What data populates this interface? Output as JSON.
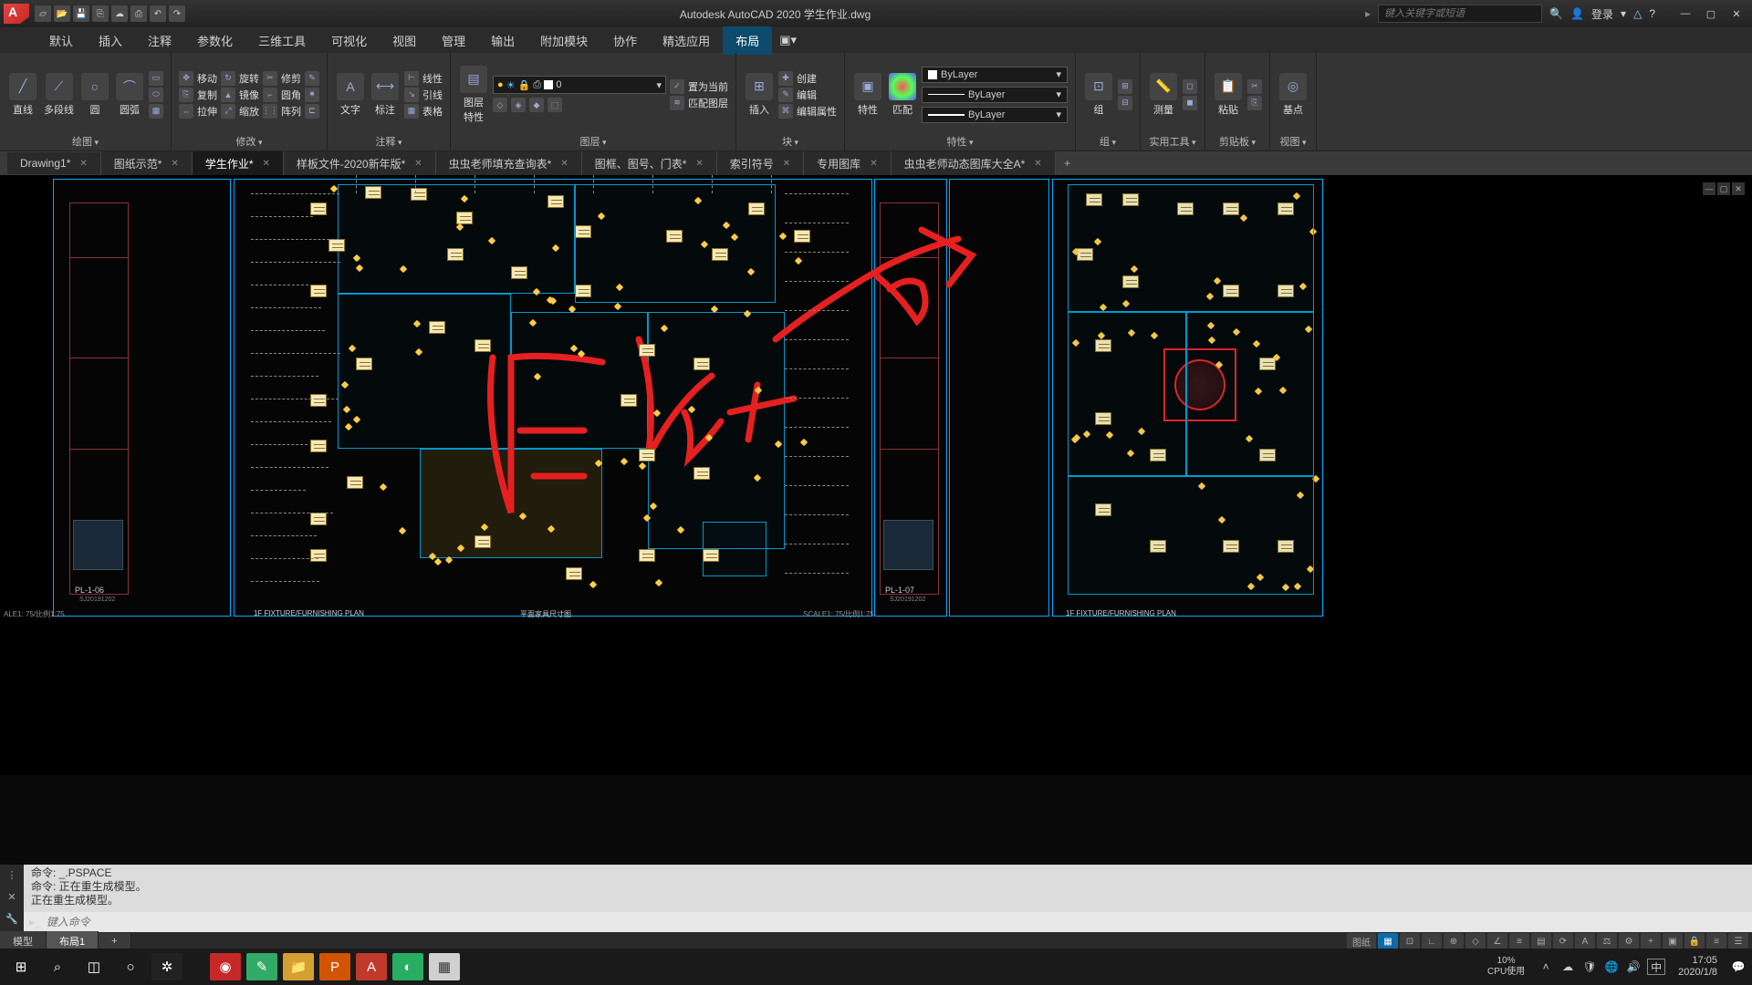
{
  "app": {
    "title": "Autodesk AutoCAD 2020   学生作业.dwg",
    "search_placeholder": "键入关键字或短语",
    "login": "登录"
  },
  "menu": {
    "items": [
      "默认",
      "插入",
      "注释",
      "参数化",
      "三维工具",
      "可视化",
      "视图",
      "管理",
      "输出",
      "附加模块",
      "协作",
      "精选应用",
      "布局"
    ],
    "active": 12
  },
  "ribbon": {
    "draw": {
      "label": "绘图",
      "line": "直线",
      "pline": "多段线",
      "circle": "圆",
      "arc": "圆弧"
    },
    "modify": {
      "label": "修改",
      "move": "移动",
      "rotate": "旋转",
      "trim": "修剪",
      "copy": "复制",
      "mirror": "镜像",
      "fillet": "圆角",
      "stretch": "拉伸",
      "scale": "缩放",
      "array": "阵列"
    },
    "annot": {
      "label": "注释",
      "text": "文字",
      "dim": "标注",
      "linear": "线性",
      "leader": "引线",
      "table": "表格"
    },
    "layers": {
      "label": "图层",
      "props": "图层\n特性",
      "current": "0",
      "setcur": "置为当前",
      "match": "匹配图层"
    },
    "block": {
      "label": "块",
      "insert": "插入",
      "create": "创建",
      "edit": "编辑",
      "editattr": "编辑属性"
    },
    "props": {
      "label": "特性",
      "prop": "特性",
      "match": "匹配",
      "bylayer": "ByLayer",
      "bylayer2": "ByLayer",
      "bylayer3": "ByLayer"
    },
    "group": {
      "label": "组",
      "grp": "组"
    },
    "util": {
      "label": "实用工具",
      "measure": "测量"
    },
    "clip": {
      "label": "剪贴板",
      "paste": "粘贴"
    },
    "view": {
      "label": "视图",
      "base": "基点"
    }
  },
  "tabs": {
    "items": [
      {
        "name": "Drawing1*"
      },
      {
        "name": "图纸示范*"
      },
      {
        "name": "学生作业*"
      },
      {
        "name": "样板文件-2020新年版*"
      },
      {
        "name": "虫虫老师填充查询表*"
      },
      {
        "name": "图框、图号、门表*"
      },
      {
        "name": "索引符号"
      },
      {
        "name": "专用图库"
      },
      {
        "name": "虫虫老师动态图库大全A*"
      }
    ],
    "active": 2
  },
  "drawing": {
    "scale_left": "ALE1: 75/比例1:75",
    "scale_right": "SCALE1: 75/比例1:75",
    "plan1_title": "1F FIXTURE/FURNISHING PLAN",
    "plan2_title": "平面家具尺寸图",
    "plan3_title": "1F FIXTURE/FURNISHING PLAN",
    "block1": "PL-1-06",
    "block1_date": "SJ20191202",
    "block2": "PL-1-07",
    "block2_date": "SJ20191202"
  },
  "cmd": {
    "l1": "命令: _.PSPACE",
    "l2": "命令: 正在重生成模型。",
    "l3": "正在重生成模型。",
    "placeholder": "键入命令"
  },
  "layout": {
    "model": "模型",
    "layout1": "布局1"
  },
  "status": {
    "paper": "图纸"
  },
  "taskbar": {
    "cpu_pct": "10%",
    "cpu_lbl": "CPU使用",
    "ime": "中",
    "time": "17:05",
    "date": "2020/1/8"
  }
}
